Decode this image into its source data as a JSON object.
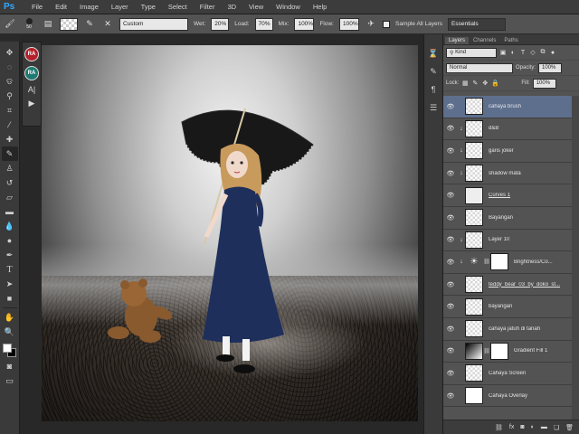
{
  "app": {
    "logo": "Ps"
  },
  "menu": [
    "File",
    "Edit",
    "Image",
    "Layer",
    "Type",
    "Select",
    "Filter",
    "3D",
    "View",
    "Window",
    "Help"
  ],
  "options": {
    "brush_size": "50",
    "preset": "Custom",
    "wet_label": "Wet:",
    "wet_value": "20%",
    "load_label": "Load:",
    "load_value": "70%",
    "mix_label": "Mix:",
    "mix_value": "100%",
    "flow_label": "Flow:",
    "flow_value": "100%",
    "sample_all_layers": "Sample All Layers",
    "workspace": "Essentials"
  },
  "mini_panel": {
    "badge1": "RA",
    "badge2": "RA"
  },
  "layers_panel": {
    "tabs": [
      "Layers",
      "Channels",
      "Paths"
    ],
    "filter": "Kind",
    "blend_mode": "Normal",
    "opacity_label": "Opacity:",
    "opacity_value": "100%",
    "lock_label": "Lock:",
    "fill_label": "Fill:",
    "fill_value": "100%",
    "layers": [
      {
        "name": "cahaya brush",
        "thumb": "checker",
        "selected": true,
        "clipped": false,
        "mask": false
      },
      {
        "name": "d&B",
        "thumb": "checker",
        "selected": false,
        "clipped": true,
        "mask": false
      },
      {
        "name": "garis joker",
        "thumb": "checker",
        "selected": false,
        "clipped": true,
        "mask": false
      },
      {
        "name": "shadow mata",
        "thumb": "checker",
        "selected": false,
        "clipped": true,
        "mask": false
      },
      {
        "name": "Curves 1",
        "thumb": "figure",
        "selected": false,
        "clipped": false,
        "mask": false
      },
      {
        "name": "Bayangan",
        "thumb": "checker",
        "selected": false,
        "clipped": false,
        "mask": false
      },
      {
        "name": "Layer 10",
        "thumb": "checker",
        "selected": false,
        "clipped": true,
        "mask": false
      },
      {
        "name": "Brightness/Co...",
        "thumb": "sun",
        "selected": false,
        "clipped": true,
        "mask": true
      },
      {
        "name": "teddy_bear_03_by_doko_st...",
        "thumb": "checker",
        "selected": false,
        "clipped": false,
        "mask": false
      },
      {
        "name": "bayangan",
        "thumb": "checker",
        "selected": false,
        "clipped": false,
        "mask": false
      },
      {
        "name": "cahaya jatuh di tanah",
        "thumb": "checker",
        "selected": false,
        "clipped": false,
        "mask": false
      },
      {
        "name": "Gradient Fill 1",
        "thumb": "grad",
        "selected": false,
        "clipped": false,
        "mask": true
      },
      {
        "name": "Cahaya Screen",
        "thumb": "checker",
        "selected": false,
        "clipped": false,
        "mask": false
      },
      {
        "name": "Cahaya Overlay",
        "thumb": "white",
        "selected": false,
        "clipped": false,
        "mask": false
      }
    ],
    "footer_icons": [
      "link-icon",
      "fx-icon",
      "mask-icon",
      "adjustment-icon",
      "folder-icon",
      "new-layer-icon",
      "trash-icon"
    ]
  },
  "colors": {
    "foreground": "#ffffff",
    "background": "#000000",
    "selected_layer": "#5d6f8d"
  }
}
